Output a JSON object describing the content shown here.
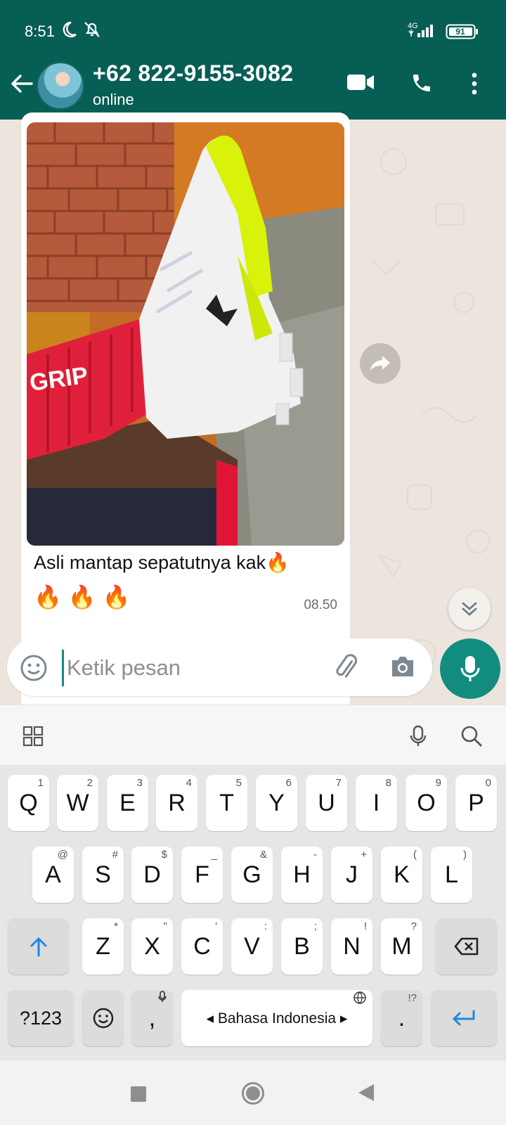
{
  "status_bar": {
    "time": "8:51",
    "network": "4G",
    "battery": "91"
  },
  "header": {
    "contact_name": "+62 822-9155-3082",
    "contact_status": "online"
  },
  "message": {
    "caption": "Asli mantap sepatutnya kak🔥",
    "emojis": "🔥 🔥 🔥",
    "time": "08.50",
    "photo_sock_text": "GRIP"
  },
  "composer": {
    "placeholder": "Ketik pesan"
  },
  "keyboard": {
    "row1": [
      {
        "key": "Q",
        "hint": "1"
      },
      {
        "key": "W",
        "hint": "2"
      },
      {
        "key": "E",
        "hint": "3"
      },
      {
        "key": "R",
        "hint": "4"
      },
      {
        "key": "T",
        "hint": "5"
      },
      {
        "key": "Y",
        "hint": "6"
      },
      {
        "key": "U",
        "hint": "7"
      },
      {
        "key": "I",
        "hint": "8"
      },
      {
        "key": "O",
        "hint": "9"
      },
      {
        "key": "P",
        "hint": "0"
      }
    ],
    "row2": [
      {
        "key": "A",
        "hint": "@"
      },
      {
        "key": "S",
        "hint": "#"
      },
      {
        "key": "D",
        "hint": "$"
      },
      {
        "key": "F",
        "hint": "_"
      },
      {
        "key": "G",
        "hint": "&"
      },
      {
        "key": "H",
        "hint": "-"
      },
      {
        "key": "J",
        "hint": "+"
      },
      {
        "key": "K",
        "hint": "("
      },
      {
        "key": "L",
        "hint": ")"
      }
    ],
    "row3": [
      {
        "key": "Z",
        "hint": "*"
      },
      {
        "key": "X",
        "hint": "\""
      },
      {
        "key": "C",
        "hint": "'"
      },
      {
        "key": "V",
        "hint": ":"
      },
      {
        "key": "B",
        "hint": ";"
      },
      {
        "key": "N",
        "hint": "!"
      },
      {
        "key": "M",
        "hint": "?"
      }
    ],
    "symbols_key": "?123",
    "comma_key": ",",
    "space_label": "◂ Bahasa Indonesia ▸",
    "period_key": ".",
    "period_hint": "!?"
  },
  "colors": {
    "header": "#075e54",
    "accent": "#128c7e",
    "chat_bg": "#ece5dd"
  }
}
